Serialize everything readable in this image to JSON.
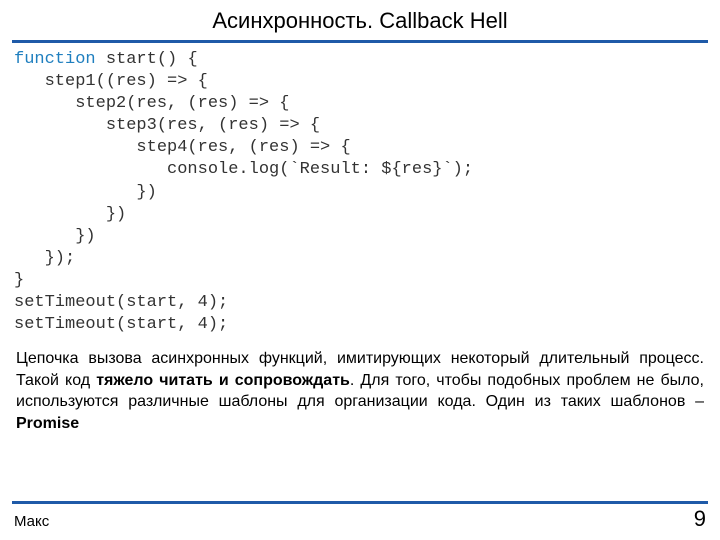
{
  "title": "Асинхронность. Callback Hell",
  "code": {
    "kw": "function",
    "rest": " start() {\n   step1((res) => {\n      step2(res, (res) => {\n         step3(res, (res) => {\n            step4(res, (res) => {\n               console.log(`Result: ${res}`);\n            })\n         })\n      })\n   });\n}\nsetTimeout(start, 4);\nsetTimeout(start, 4);"
  },
  "para": {
    "p1": "Цепочка вызова асинхронных функций, имитирующих некоторый длительный процесс. Такой код ",
    "b1": "тяжело читать и сопровождать",
    "p2": ". Для того, чтобы подобных проблем не было, используются различные шаблоны для организации кода. Один из таких шаблонов – ",
    "b2": "Promise"
  },
  "footer": {
    "author": "Макс",
    "page": "9"
  }
}
